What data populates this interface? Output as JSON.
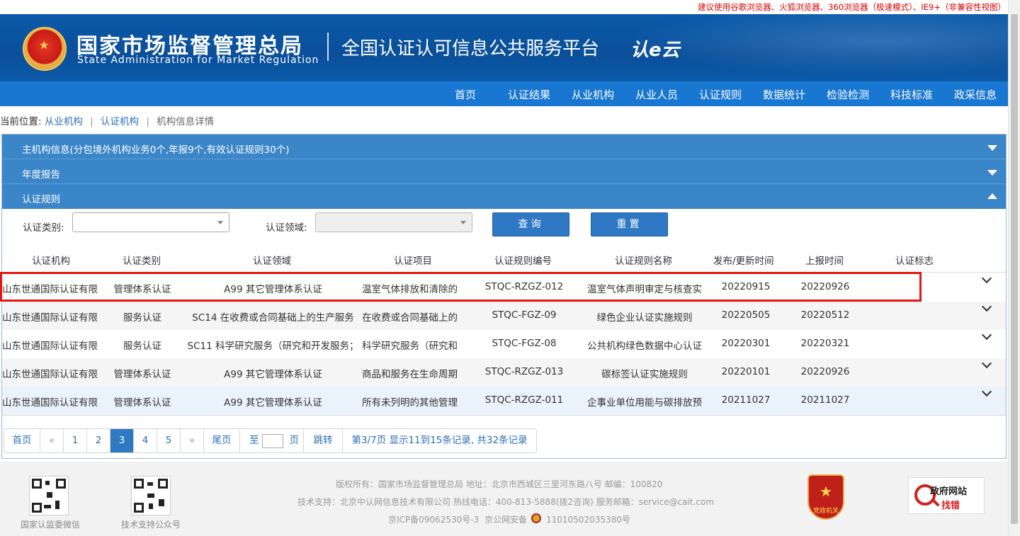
{
  "browser_notice": "建议使用谷歌浏览器、火狐浏览器、360浏览器（极速模式）、IE9+（非兼容性视图）",
  "header": {
    "org_cn": "国家市场监督管理总局",
    "org_en": "State Administration  for  Market Regulation",
    "platform": "全国认证认可信息公共服务平台",
    "brand": "认e云"
  },
  "nav": [
    "首页",
    "认证结果",
    "从业机构",
    "从业人员",
    "认证规则",
    "数据统计",
    "检验检测",
    "科技标准",
    "政采信息"
  ],
  "breadcrumb": {
    "prefix": "当前位置:",
    "items": [
      "从业机构",
      "认证机构",
      "机构信息详情"
    ],
    "sep": "|"
  },
  "accordion": [
    {
      "title": "主机构信息(分包境外机构业务0个,年报9个,有效认证规则30个)",
      "state": "collapsed"
    },
    {
      "title": "年度报告",
      "state": "collapsed"
    },
    {
      "title": "认证规则",
      "state": "expanded"
    }
  ],
  "filters": {
    "type_label": "认证类别:",
    "type_value": "",
    "field_label": "认证领域:",
    "field_value": "",
    "query_button": "查询",
    "reset_button": "重置"
  },
  "table": {
    "columns": [
      "认证机构",
      "认证类别",
      "认证领域",
      "认证项目",
      "认证规则编号",
      "认证规则名称",
      "发布/更新时间",
      "上报时间",
      "认证标志"
    ],
    "rows": [
      [
        "山东世通国际认证有限",
        "管理体系认证",
        "A99 其它管理体系认证",
        "温室气体排放和清除的",
        "STQC-RZGZ-012",
        "温室气体声明审定与核查实",
        "20220915",
        "20220926"
      ],
      [
        "山东世通国际认证有限",
        "服务认证",
        "SC14 在收费或合同基础上的生产服务",
        "在收费或合同基础上的",
        "STQC-FGZ-09",
        "绿色企业认证实施规则",
        "20220505",
        "20220512"
      ],
      [
        "山东世通国际认证有限",
        "服务认证",
        "SC11 科学研究服务（研究和开发服务；",
        "科学研究服务（研究和",
        "STQC-FGZ-08",
        "公共机构绿色数据中心认证",
        "20220301",
        "20220321"
      ],
      [
        "山东世通国际认证有限",
        "管理体系认证",
        "A99 其它管理体系认证",
        "商品和服务在生命周期",
        "STQC-RZGZ-013",
        "碳标签认证实施规则",
        "20220101",
        "20220926"
      ],
      [
        "山东世通国际认证有限",
        "管理体系认证",
        "A99 其它管理体系认证",
        "所有未列明的其他管理",
        "STQC-RZGZ-011",
        "企事业单位用能与碳排放预",
        "20211027",
        "20211027"
      ]
    ]
  },
  "pagination": {
    "first": "首页",
    "prev": "«",
    "pages": [
      "1",
      "2",
      "3",
      "4",
      "5"
    ],
    "current": "3",
    "next": "»",
    "last": "尾页",
    "goto_prefix": "至",
    "goto_suffix": "页",
    "jump": "跳转",
    "summary": "第3/7页  显示11到15条记录, 共32条记录"
  },
  "footer": {
    "qr1_caption": "国家认监委微信",
    "qr2_caption": "技术支持公众号",
    "line1": "版权所有：国家市场监督管理总局    地址：北京市西城区三里河东路八号    邮编：100820",
    "line2": "技术支持：北京中认网信息技术有限公司    热线电话：400-813-5888(拨2咨询)    服务邮箱：service@cait.com",
    "icp": "京ICP备09062530号-3",
    "police": "京公网安备",
    "police_no": "11010502035380号",
    "party_label": "党政机关",
    "gov_site_line1": "政府网站",
    "gov_site_line2": "找错"
  },
  "colors": {
    "banner": "#0b5aa8",
    "nav": "#1877d1",
    "accordion": "#3a86c8",
    "button": "#2f78c4",
    "highlight": "#e81414",
    "notice": "#d40000"
  }
}
